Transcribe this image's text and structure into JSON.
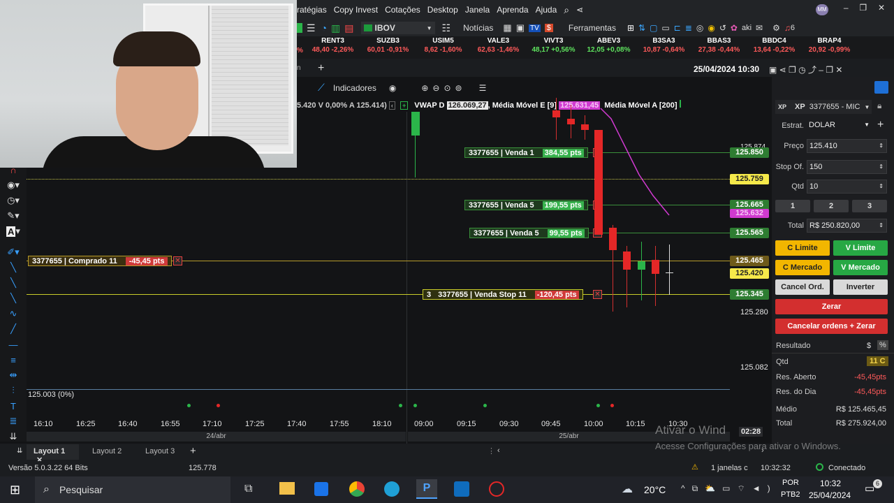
{
  "menu": {
    "items": [
      "ratégias",
      "Copy Invest",
      "Cotações",
      "Desktop",
      "Janela",
      "Aprenda",
      "Ajuda"
    ]
  },
  "toolbar": {
    "symbol": "IBOV",
    "news": "Notícias",
    "tools": "Ferramentas",
    "akt": "aki",
    "badge": "6"
  },
  "tickers": [
    {
      "name": "RENT3",
      "value": "48,40 -2,26%",
      "dir": "neg"
    },
    {
      "name": "SUZB3",
      "value": "60,01 -0,91%",
      "dir": "neg"
    },
    {
      "name": "USIM5",
      "value": "8,62 -1,60%",
      "dir": "neg"
    },
    {
      "name": "VALE3",
      "value": "62,63 -1,46%",
      "dir": "neg"
    },
    {
      "name": "VIVT3",
      "value": "48,17 +0,56%",
      "dir": "pos"
    },
    {
      "name": "ABEV3",
      "value": "12,05 +0,08%",
      "dir": "pos"
    },
    {
      "name": "B3SA3",
      "value": "10,87 -0,64%",
      "dir": "neg"
    },
    {
      "name": "BBAS3",
      "value": "27,38 -0,44%",
      "dir": "neg"
    },
    {
      "name": "BBDC4",
      "value": "13,64 -0,22%",
      "dir": "neg"
    },
    {
      "name": "BRAP4",
      "value": "20,92 -0,99%",
      "dir": "neg"
    }
  ],
  "ticker_prefix": "%",
  "header": {
    "datetime": "25/04/2024 10:30"
  },
  "chart_toolbar": {
    "indicators": "Indicadores"
  },
  "chart_info": {
    "left": "5.420 V 0,00% A 125.414)",
    "vwap": "VWAP D",
    "vwap_val": "126.069,27",
    "mme": ", Média Móvel E [9]",
    "mme_val": "125.631,45",
    "mma": "Média Móvel A [200]"
  },
  "orders": [
    {
      "label": "3377655 | Venda 1",
      "pts": "384,55 pts"
    },
    {
      "label": "3377655 | Venda 5",
      "pts": "199,55 pts"
    },
    {
      "label": "3377655 | Venda 5",
      "pts": "99,55 pts"
    },
    {
      "label": "3377655 | Comprado 11",
      "pts": "-45,45 pts"
    },
    {
      "label": "3377655 | Venda Stop 11",
      "pts": "-120,45 pts",
      "qty": "3"
    }
  ],
  "prices": {
    "p1": "125.874",
    "p2": "125.850",
    "p3": "125.759",
    "p4": "125.665",
    "p5": "125.632",
    "p6": "125.565",
    "p7": "125.465",
    "p8": "125.420",
    "p9": "125.345",
    "p10": "125.280",
    "p11": "125.082",
    "left_bottom": "125.003 (0%)",
    "countdown": "02:28"
  },
  "xaxis": {
    "times": [
      "16:10",
      "16:25",
      "16:40",
      "16:55",
      "17:10",
      "17:25",
      "17:40",
      "17:55",
      "18:10",
      "09:00",
      "09:15",
      "09:30",
      "09:45",
      "10:00",
      "10:15",
      "10:30"
    ],
    "dates": [
      "24/abr",
      "25/abr"
    ]
  },
  "panel": {
    "account": "3377655 - MIC",
    "broker": "XP",
    "estrat_label": "Estrat.",
    "estrat": "DOLAR",
    "preco_label": "Preço",
    "preco": "125.410",
    "stop_label": "Stop Of.",
    "stop": "150",
    "qtd_label": "Qtd",
    "qtd": "10",
    "b1": "1",
    "b2": "2",
    "b3": "3",
    "total_label": "Total",
    "total": "R$ 250.820,00",
    "c_limite": "C Limite",
    "v_limite": "V Limite",
    "c_mercado": "C Mercado",
    "v_mercado": "V Mercado",
    "cancel": "Cancel Ord.",
    "inverter": "Inverter",
    "zerar": "Zerar",
    "cancel_zerar": "Cancelar ordens + Zerar",
    "resultado": "Resultado",
    "currency": "$",
    "pct": "%",
    "rows": [
      {
        "k": "Qtd",
        "v": "11 C"
      },
      {
        "k": "Res. Aberto",
        "v": "-45,45pts"
      },
      {
        "k": "Res. do Dia",
        "v": "-45,45pts"
      },
      {
        "k": "Médio",
        "v": "R$ 125.465,45"
      },
      {
        "k": "Total",
        "v": "R$ 275.924,00"
      }
    ]
  },
  "tabs": [
    "Layout 1",
    "Layout 2",
    "Layout 3"
  ],
  "status": {
    "version": "Versão 5.0.3.22 64 Bits",
    "price": "125.778",
    "windows": "1 janelas c",
    "time": "10:32:32",
    "conn": "Conectado"
  },
  "watermark": {
    "line1": "Ativar o Wind",
    "line2": "Acesse Configurações para ativar o Windows."
  },
  "taskbar": {
    "search": "Pesquisar",
    "temp": "20°C",
    "lang1": "POR",
    "lang2": "PTB2",
    "time": "10:32",
    "date": "25/04/2024",
    "notif": "6"
  }
}
